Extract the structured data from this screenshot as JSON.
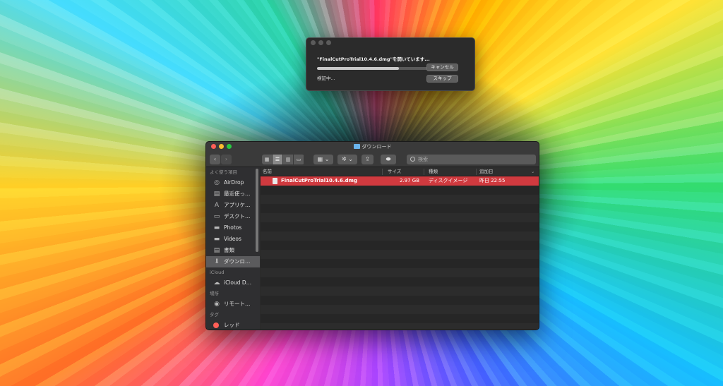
{
  "dialog": {
    "message": "\"FinalCutProTrial10.4.6.dmg\"を開いています...",
    "progress": 0.65,
    "status": "検証中...",
    "cancel_label": "キャンセル",
    "skip_label": "スキップ"
  },
  "finder": {
    "title": "ダウンロード",
    "search_placeholder": "検索",
    "sidebar": {
      "favorites_header": "よく使う項目",
      "favorites": [
        {
          "label": "AirDrop",
          "icon": "airdrop-icon"
        },
        {
          "label": "最近使っ…",
          "icon": "recents-icon"
        },
        {
          "label": "アプリケ…",
          "icon": "applications-icon"
        },
        {
          "label": "デスクト…",
          "icon": "desktop-icon"
        },
        {
          "label": "Photos",
          "icon": "folder-icon"
        },
        {
          "label": "Videos",
          "icon": "folder-icon"
        },
        {
          "label": "書類",
          "icon": "documents-icon"
        },
        {
          "label": "ダウンロ…",
          "icon": "downloads-icon"
        }
      ],
      "icloud_header": "iCloud",
      "icloud": [
        {
          "label": "iCloud D…",
          "icon": "cloud-icon"
        }
      ],
      "locations_header": "場所",
      "locations": [
        {
          "label": "リモート…",
          "icon": "remote-disc-icon"
        }
      ],
      "tags_header": "タグ",
      "tags": [
        {
          "label": "レッド",
          "color": "#ff5f57"
        }
      ]
    },
    "columns": {
      "name": "名前",
      "size": "サイズ",
      "kind": "種類",
      "date_added": "追加日"
    },
    "files": [
      {
        "name": "FinalCutProTrial10.4.6.dmg",
        "size": "2.97 GB",
        "kind": "ディスクイメージ",
        "date_added": "昨日 22:55"
      }
    ]
  },
  "colors": {
    "selection": "#d03a3f",
    "window_bg": "#2a2a2a"
  }
}
